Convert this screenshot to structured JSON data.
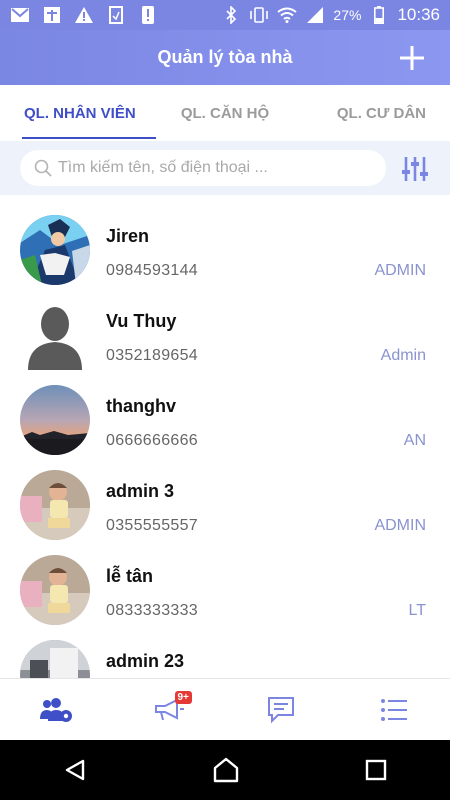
{
  "status_bar": {
    "battery": "27%",
    "time": "10:36",
    "left_icons": [
      "mail-icon",
      "calendar-icon",
      "warning-icon",
      "sim-icon",
      "alert-icon"
    ],
    "right_icons": [
      "bluetooth-icon",
      "vibrate-icon",
      "wifi-icon",
      "signal-icon",
      "battery-icon"
    ]
  },
  "header": {
    "title": "Quản lý tòa nhà",
    "add_icon": "plus-icon",
    "color": "#7b86e3"
  },
  "tabs": [
    {
      "label": "QL. NHÂN VIÊN",
      "active": true
    },
    {
      "label": "QL. CĂN HỘ",
      "active": false
    },
    {
      "label": "QL. CƯ DÂN",
      "active": false
    }
  ],
  "search": {
    "placeholder": "Tìm kiếm tên, số điện thoại ...",
    "value": "",
    "filter_icon": "sliders-icon"
  },
  "employees": [
    {
      "name": "Jiren",
      "phone": "0984593144",
      "role": "ADMIN",
      "avatar": "anime"
    },
    {
      "name": "Vu Thuy",
      "phone": "0352189654",
      "role": "Admin",
      "avatar": "placeholder"
    },
    {
      "name": "thanghv",
      "phone": "0666666666",
      "role": "AN",
      "avatar": "sunset"
    },
    {
      "name": "admin 3",
      "phone": "0355555557",
      "role": "ADMIN",
      "avatar": "baby"
    },
    {
      "name": "lễ tân",
      "phone": "0833333333",
      "role": "LT",
      "avatar": "baby"
    },
    {
      "name": "admin 23",
      "phone": "",
      "role": "",
      "avatar": "person"
    }
  ],
  "bottom_nav": [
    {
      "icon": "users-settings-icon",
      "active": true
    },
    {
      "icon": "megaphone-icon",
      "badge": "9+"
    },
    {
      "icon": "chat-icon"
    },
    {
      "icon": "list-icon"
    }
  ],
  "colors": {
    "accent": "#3f4fc7",
    "role_text": "#8a93cf",
    "search_bg": "#eef2fb"
  }
}
